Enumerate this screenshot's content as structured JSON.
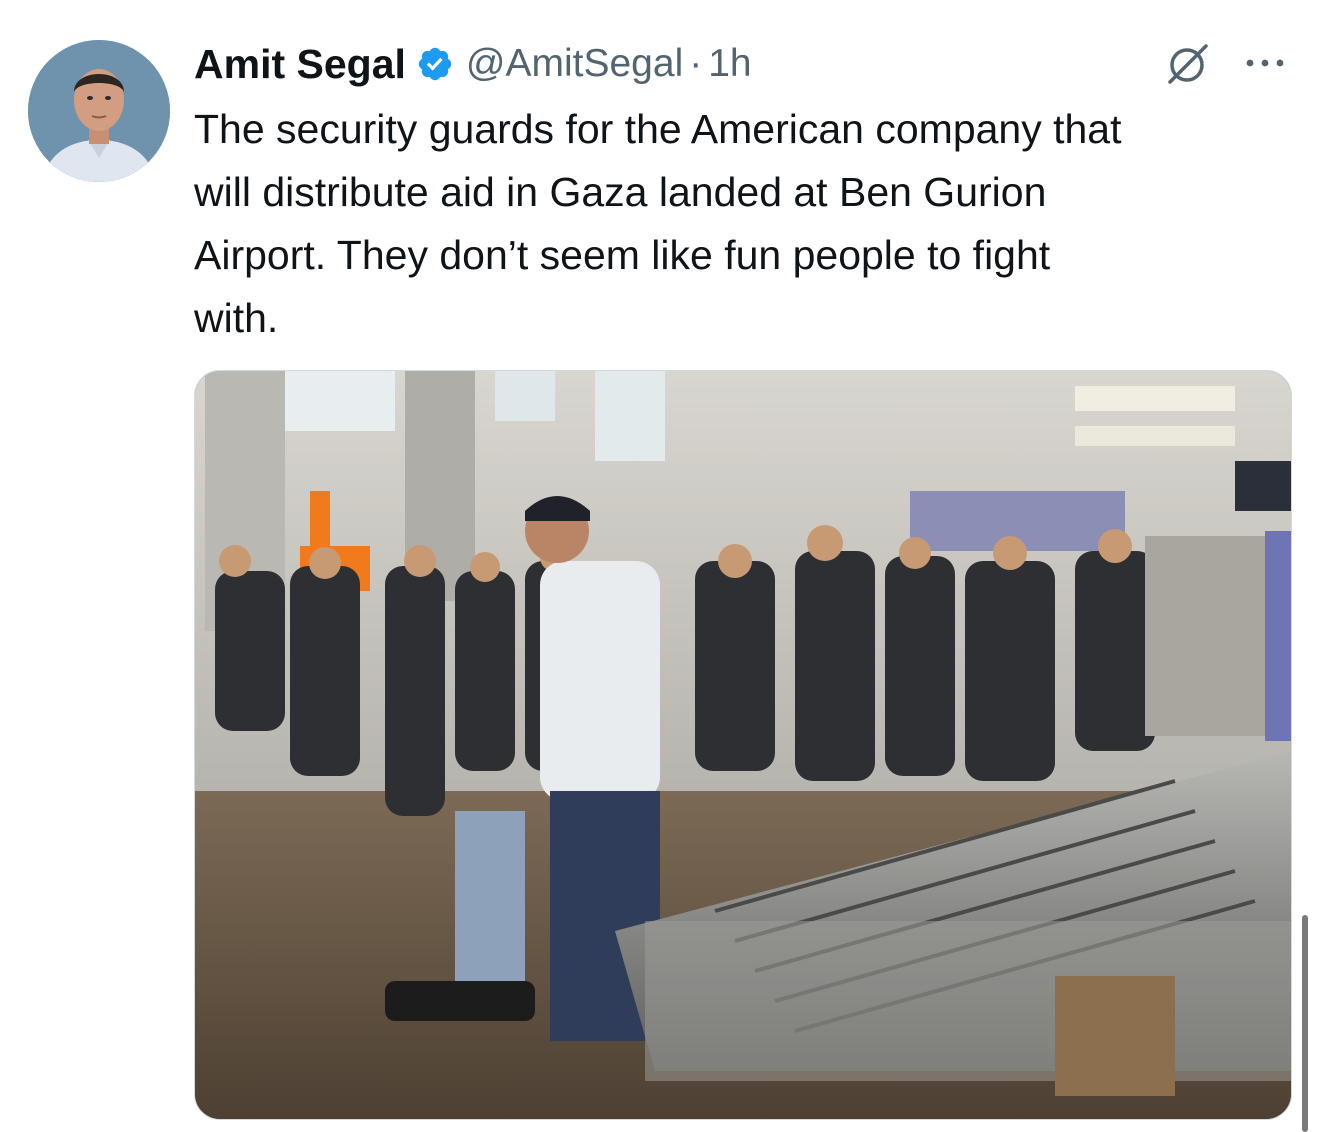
{
  "tweet": {
    "author_name": "Amit Segal",
    "handle": "@AmitSegal",
    "separator": "·",
    "time": "1h",
    "text": "The security guards for the American company that\nwill distribute aid in Gaza landed at Ben Gurion\nAirport. They don’t seem like fun people to fight\nwith."
  },
  "icons": {
    "verified": "verified-badge-icon",
    "grok": "grok-icon",
    "more": "more-options-icon"
  },
  "colors": {
    "verified_blue": "#1d9bf0",
    "secondary_text": "#536471",
    "primary_text": "#0f1419"
  }
}
